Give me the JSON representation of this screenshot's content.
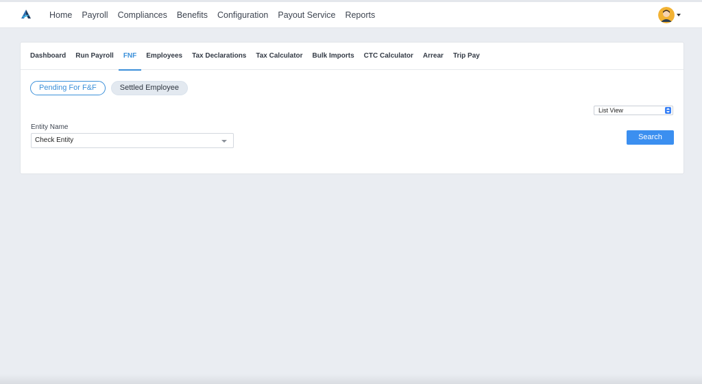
{
  "header": {
    "nav_items": [
      "Home",
      "Payroll",
      "Compliances",
      "Benefits",
      "Configuration",
      "Payout Service",
      "Reports"
    ]
  },
  "subnav": {
    "tabs": [
      "Dashboard",
      "Run Payroll",
      "FNF",
      "Employees",
      "Tax Declarations",
      "Tax Calculator",
      "Bulk Imports",
      "CTC Calculator",
      "Arrear",
      "Trip Pay"
    ],
    "active_tab": "FNF"
  },
  "filters": {
    "pending_label": "Pending For F&F",
    "settled_label": "Settled Employee"
  },
  "view_select": {
    "value": "List View"
  },
  "entity": {
    "label": "Entity Name",
    "value": "Check Entity"
  },
  "search_label": "Search",
  "colors": {
    "accent": "#3a8fd9",
    "button": "#3b8ff0",
    "background": "#eaedf2"
  }
}
